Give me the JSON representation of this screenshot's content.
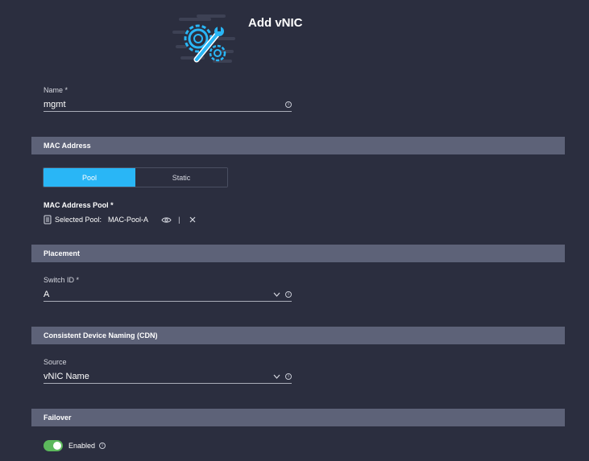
{
  "dialog": {
    "title": "Add vNIC"
  },
  "name_field": {
    "label": "Name *",
    "value": "mgmt"
  },
  "mac_section": {
    "header": "MAC Address",
    "toggle": {
      "options": [
        "Pool",
        "Static"
      ],
      "selected": "Pool"
    },
    "pool_label": "MAC Address Pool *",
    "selected_prefix": "Selected Pool:",
    "selected_pool": "MAC-Pool-A",
    "separator": "|"
  },
  "placement_section": {
    "header": "Placement",
    "switch_id": {
      "label": "Switch ID *",
      "value": "A"
    }
  },
  "cdn_section": {
    "header": "Consistent Device Naming (CDN)",
    "source": {
      "label": "Source",
      "value": "vNIC Name"
    }
  },
  "failover_section": {
    "header": "Failover",
    "toggle_label": "Enabled",
    "enabled": true
  },
  "colors": {
    "accent": "#29b6f6",
    "toggle_on": "#5cb85c",
    "section_bg": "#5d6278",
    "page_bg": "#2b2e3f"
  },
  "icons": [
    "gear-wrench-icon",
    "info-icon",
    "chevron-down-icon",
    "document-icon",
    "eye-icon",
    "close-icon"
  ]
}
